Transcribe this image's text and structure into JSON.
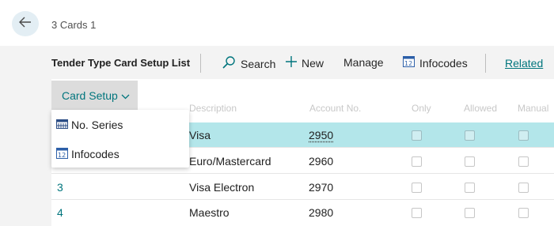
{
  "breadcrumb": "3 Cards 1",
  "page_title": "Tender Type Card Setup List",
  "actions": {
    "search": "Search",
    "new": "New",
    "manage": "Manage",
    "infocodes": "Infocodes",
    "related": "Related"
  },
  "menu": {
    "label": "Card Setup",
    "items": [
      {
        "label": "No. Series",
        "icon": "no-series-icon"
      },
      {
        "label": "Infocodes",
        "icon": "infocodes-icon"
      }
    ]
  },
  "faint_headers": [
    "Description",
    "Account No.",
    "Only",
    "Allowed",
    "Manual"
  ],
  "rows": [
    {
      "code": "",
      "description": "Visa",
      "account": "2950",
      "selected": true
    },
    {
      "code": "",
      "description": "Euro/Mastercard",
      "account": "2960",
      "selected": false
    },
    {
      "code": "3",
      "description": "Visa Electron",
      "account": "2970",
      "selected": false
    },
    {
      "code": "4",
      "description": "Maestro",
      "account": "2980",
      "selected": false
    }
  ],
  "colors": {
    "accent": "#00757d",
    "selected_row": "#b3e6ea"
  }
}
